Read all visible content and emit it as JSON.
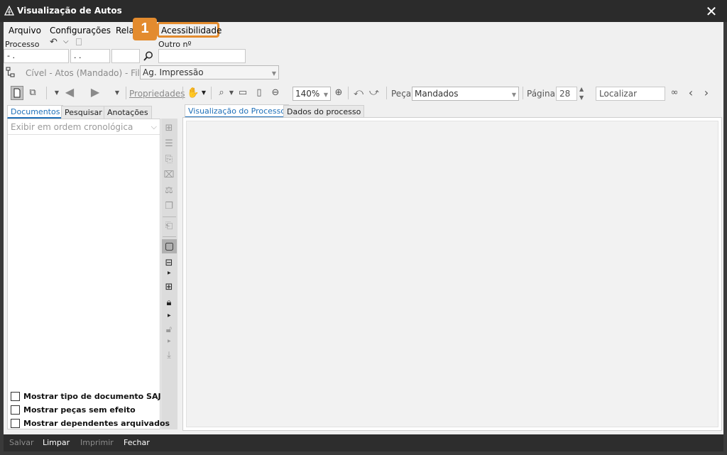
{
  "window": {
    "title": "Visualização de Autos"
  },
  "menu": [
    {
      "label": "Arquivo"
    },
    {
      "label": "Configurações"
    },
    {
      "label": "Relat"
    },
    {
      "label": "Acessibilidade"
    }
  ],
  "callout": {
    "number": "1",
    "color": "#e38b2e"
  },
  "processo": {
    "label": "Processo",
    "field1": "- .",
    "field2": ". .",
    "field3": "",
    "outro_label": "Outro nº",
    "outro_value": ""
  },
  "fila": {
    "text": "Cível - Atos (Mandado) - Fila:",
    "value": "Ag. Impressão"
  },
  "toolbar": {
    "propriedades": "Propriedades",
    "zoom": "140%",
    "peca_label": "Peça",
    "peca_value": "Mandados",
    "pagina_label": "Página",
    "pagina_value": "28",
    "localizar": "Localizar"
  },
  "left_tabs": [
    {
      "label": "Documentos",
      "active": true
    },
    {
      "label": "Pesquisar",
      "active": false
    },
    {
      "label": "Anotações",
      "active": false
    }
  ],
  "order_placeholder": "Exibir em ordem cronológica",
  "checkboxes": [
    {
      "label": "Mostrar tipo de documento SAJ",
      "checked": false
    },
    {
      "label": "Mostrar peças sem efeito",
      "checked": false
    },
    {
      "label": "Mostrar dependentes arquivados",
      "checked": false
    }
  ],
  "right_tabs": [
    {
      "label": "Visualização do Processo",
      "active": true
    },
    {
      "label": "Dados do processo",
      "active": false
    }
  ],
  "status_buttons": [
    {
      "label": "Salvar",
      "enabled": false
    },
    {
      "label": "Limpar",
      "enabled": true
    },
    {
      "label": "Imprimir",
      "enabled": false
    },
    {
      "label": "Fechar",
      "enabled": true
    }
  ],
  "colors": {
    "accent": "#1e6fb8",
    "titlebar": "#2b2b2b",
    "callout": "#e38b2e"
  }
}
